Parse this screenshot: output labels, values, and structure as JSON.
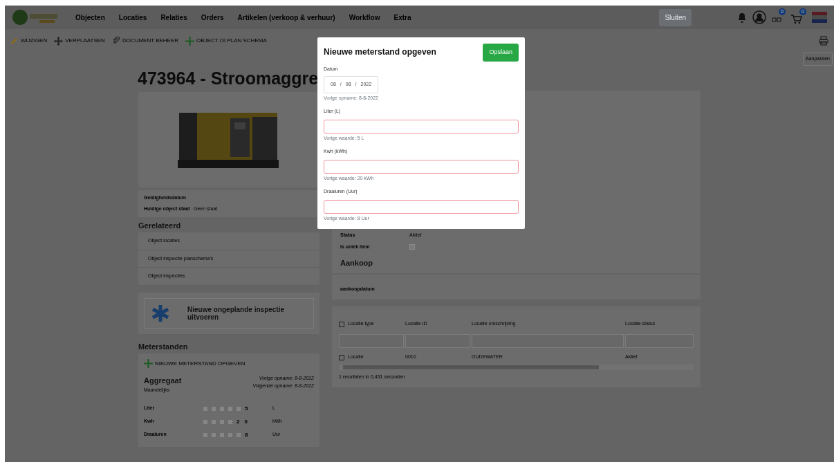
{
  "nav": {
    "items": [
      "Objecten",
      "Locaties",
      "Relaties",
      "Orders",
      "Artikelen (verkoop & verhuur)",
      "Workflow",
      "Extra"
    ],
    "close_button": "Sluiten",
    "badges": [
      "0",
      "0"
    ]
  },
  "toolbar": {
    "actions": [
      {
        "kind": "edit",
        "label": "WIJZIGEN"
      },
      {
        "kind": "move",
        "label": "VERPLAATSEN"
      },
      {
        "kind": "link",
        "label": "DOCUMENT BEHEER"
      },
      {
        "kind": "add",
        "label": "OBJECT OI PLAN SCHEMA"
      }
    ],
    "adjust_button": "Aanpassen"
  },
  "title": "473964 - Stroomaggre",
  "details": [
    {
      "label": "Geldigheidsdatum"
    },
    {
      "label": "Huidige object staat",
      "value": "Geen staat"
    }
  ],
  "related": {
    "title": "Gerelateerd",
    "items": [
      "Object locaties",
      "Object inspectie planschema's",
      "Object inspecties"
    ]
  },
  "inspection_tile": "Nieuwe ongeplande inspectie uitvoeren",
  "meters": {
    "title": "Meterstanden",
    "add_action": "NIEUWE METERSTAND OPGEVEN",
    "name": "Aggregaat",
    "frequency": "Maandelijks",
    "previous": "Vorige opname: 8-8-2022",
    "next": "Volgende opname: 8-8-2022",
    "rows": [
      {
        "label": "Liter",
        "value": "5",
        "unit": "L"
      },
      {
        "label": "Kwh",
        "value": "20",
        "unit": "kWh"
      },
      {
        "label": "Draaiuren",
        "value": "8",
        "unit": "Uur"
      }
    ]
  },
  "status": [
    {
      "label": "Status",
      "value": "Aktief"
    },
    {
      "label": "Is uniek item",
      "checked": false
    }
  ],
  "purchase": {
    "title": "Aankoop",
    "field": "aankoopdatum"
  },
  "table": {
    "all_checked": false,
    "columns": [
      "Locatie type",
      "Locatie ID",
      "Locatie omschrijving",
      "Locatie status"
    ],
    "rows": [
      {
        "selected": false,
        "cells": [
          "Locatie",
          "0010",
          "OUDEWATER",
          "Aktief"
        ]
      }
    ],
    "footer": "1 resultaten in 0,431 seconden"
  },
  "modal": {
    "title": "Nieuwe meterstand opgeven",
    "save": "Opslaan",
    "date": {
      "label": "Datum",
      "parts": [
        "08",
        "08",
        "2022"
      ],
      "separator": "/",
      "hint": "Vorige opname: 8-8-2022"
    },
    "fields": [
      {
        "label": "Liter (L)",
        "invalid": true,
        "hint": "Vorige waarde: 5 L"
      },
      {
        "label": "Kwh (kWh)",
        "invalid": true,
        "hint": "Vorige waarde: 20 kWh"
      },
      {
        "label": "Draaiuren (Uur)",
        "invalid": true,
        "hint": "Vorige waarde: 8 Uur"
      }
    ]
  }
}
